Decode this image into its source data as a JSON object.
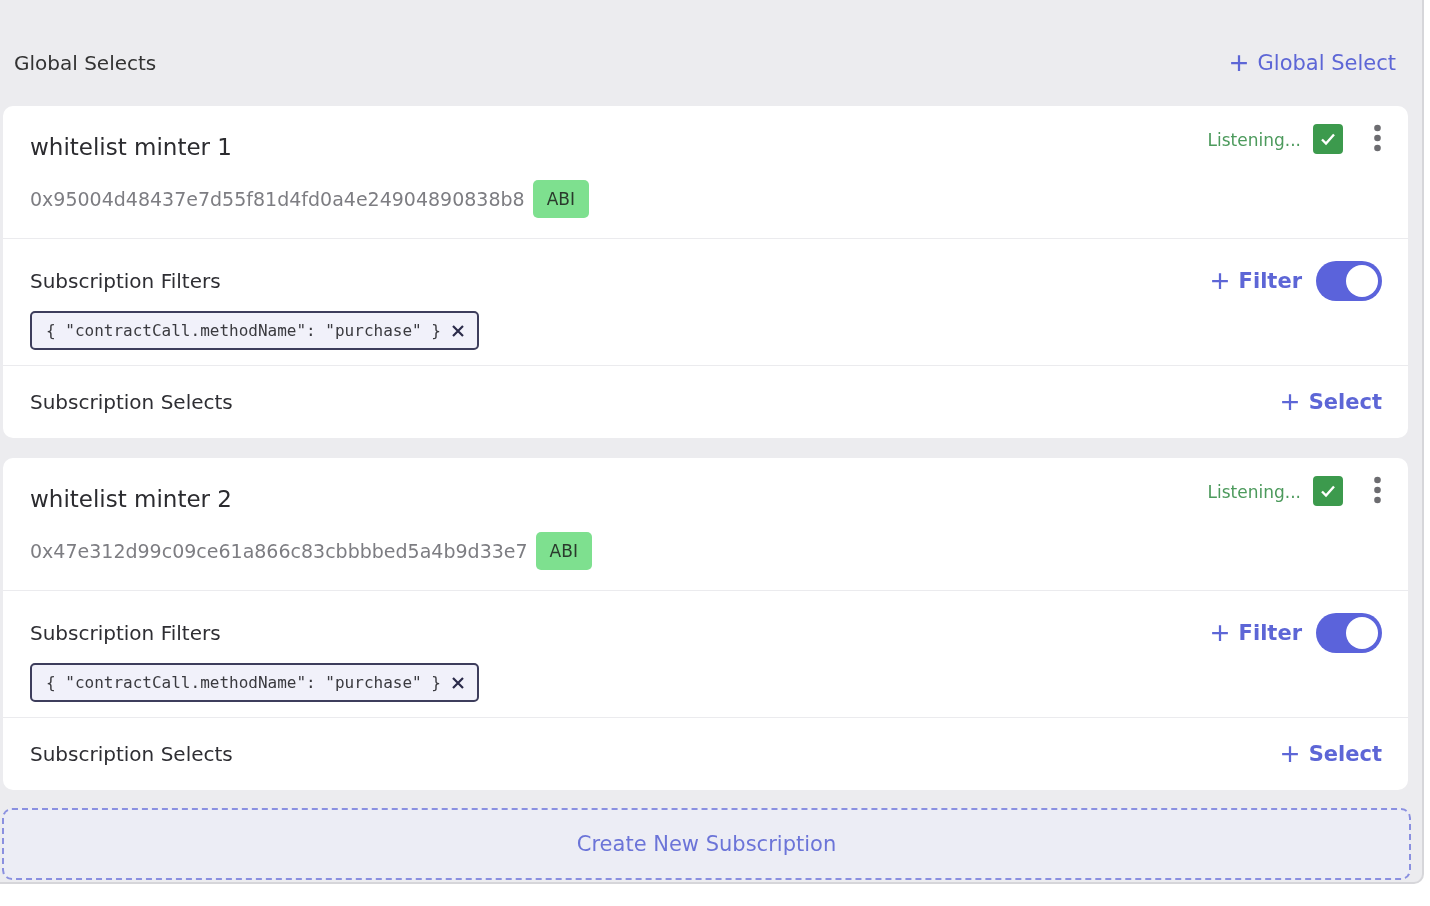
{
  "global_selects": {
    "label": "Global Selects",
    "add_button": "Global Select"
  },
  "subscriptions": [
    {
      "name": "whitelist minter 1",
      "address": "0x95004d48437e7d55f81d4fd0a4e24904890838b8",
      "abi_badge": "ABI",
      "status": "Listening...",
      "checked": true,
      "filters": {
        "label": "Subscription Filters",
        "add_button": "Filter",
        "on": true,
        "chips": [
          "{ \"contractCall.methodName\": \"purchase\" }"
        ]
      },
      "selects": {
        "label": "Subscription Selects",
        "add_button": "Select"
      }
    },
    {
      "name": "whitelist minter 2",
      "address": "0x47e312d99c09ce61a866c83cbbbbed5a4b9d33e7",
      "abi_badge": "ABI",
      "status": "Listening...",
      "checked": true,
      "filters": {
        "label": "Subscription Filters",
        "add_button": "Filter",
        "on": true,
        "chips": [
          "{ \"contractCall.methodName\": \"purchase\" }"
        ]
      },
      "selects": {
        "label": "Subscription Selects",
        "add_button": "Select"
      }
    }
  ],
  "create_button": "Create New Subscription"
}
